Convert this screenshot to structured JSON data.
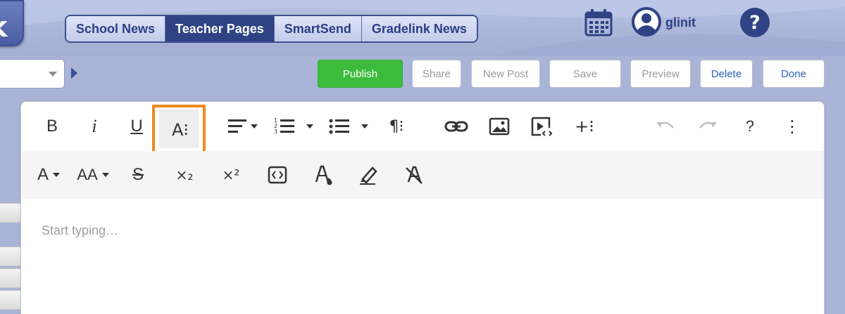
{
  "header": {
    "logo_letter": "k",
    "tabs": [
      {
        "label": "School News",
        "active": false
      },
      {
        "label": "Teacher Pages",
        "active": true
      },
      {
        "label": "SmartSend",
        "active": false
      },
      {
        "label": "Gradelink News",
        "active": false
      }
    ],
    "user_name": "glinit",
    "help_symbol": "?"
  },
  "toolbar": {
    "publish_label": "Publish",
    "share_label": "Share",
    "new_post_label": "New Post",
    "save_label": "Save",
    "preview_label": "Preview",
    "delete_label": "Delete",
    "done_label": "Done"
  },
  "editor": {
    "row1": {
      "bold": "B",
      "italic": "i",
      "underline": "U",
      "text_more": "A⁝",
      "paragraph_more": "¶⁝",
      "insert_more": "+⁝",
      "help": "?",
      "more": "⋮"
    },
    "row2": {
      "font_family": "A",
      "font_size": "AA",
      "strikethrough": "S",
      "subscript": "×₂",
      "superscript": "×²"
    },
    "placeholder": "Start typing…"
  },
  "colors": {
    "accent_blue": "#2f4384",
    "publish_green": "#3dbb3d",
    "highlight_orange": "#f08a1f",
    "link_blue": "#2c62b8"
  }
}
